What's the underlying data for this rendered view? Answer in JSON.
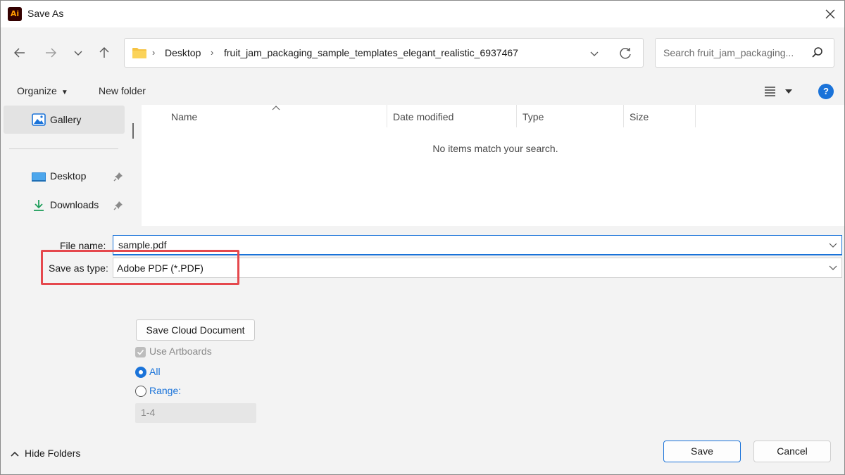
{
  "window": {
    "title": "Save As",
    "app_icon_text": "Ai",
    "icon": "illustrator-app-icon"
  },
  "navigation": {
    "back_icon": "arrow-left-icon",
    "forward_icon": "arrow-right-icon",
    "recent_icon": "chevron-down-icon",
    "up_icon": "arrow-up-icon",
    "breadcrumbs": [
      "Desktop",
      "fruit_jam_packaging_sample_templates_elegant_realistic_6937467"
    ],
    "search_placeholder": "Search fruit_jam_packaging..."
  },
  "commandbar": {
    "organize_label": "Organize",
    "new_folder_label": "New folder"
  },
  "sidebar": {
    "items": [
      {
        "label": "Gallery",
        "icon": "gallery-icon",
        "selected": true
      },
      {
        "label": "Desktop",
        "icon": "desktop-icon",
        "pinned": true
      },
      {
        "label": "Downloads",
        "icon": "download-icon",
        "pinned": true
      }
    ]
  },
  "filelist": {
    "columns": [
      "Name",
      "Date modified",
      "Type",
      "Size"
    ],
    "empty_message": "No items match your search."
  },
  "form": {
    "file_name_label": "File name:",
    "file_name_value": "sample.pdf",
    "save_as_type_label": "Save as type:",
    "save_as_type_value": "Adobe PDF (*.PDF)",
    "cloud_button_label": "Save Cloud Document",
    "use_artboards_label": "Use Artboards",
    "use_artboards_checked": true,
    "radio_all_label": "All",
    "radio_range_label": "Range:",
    "range_value": "1-4"
  },
  "footer": {
    "hide_folders_label": "Hide Folders",
    "save_label": "Save",
    "cancel_label": "Cancel"
  },
  "colors": {
    "accent": "#1a73d9",
    "highlight": "#e5484d",
    "panel_bg": "#f3f3f3"
  }
}
